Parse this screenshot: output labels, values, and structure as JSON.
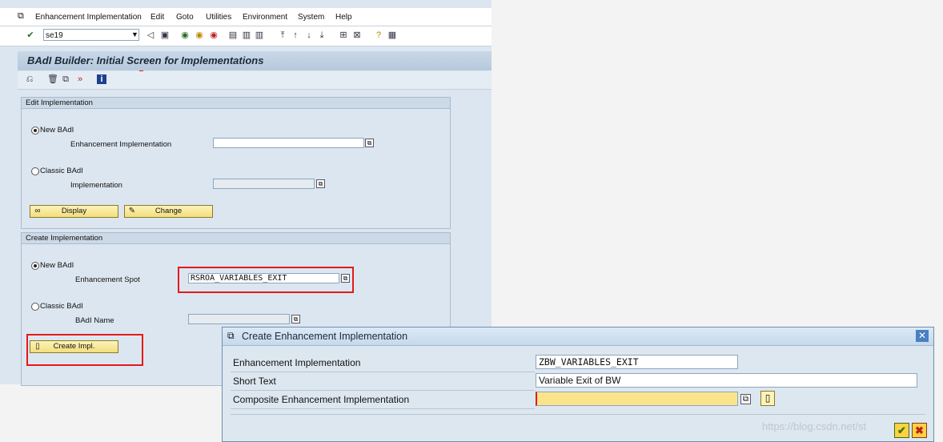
{
  "menu": [
    "Enhancement Implementation",
    "Edit",
    "Goto",
    "Utilities",
    "Environment",
    "System",
    "Help"
  ],
  "command_field": "se19",
  "screen_title": "BAdI Builder: Initial Screen for Implementations",
  "edit_group": {
    "title": "Edit Implementation",
    "radio_new": "New BAdI",
    "label_enh_impl": "Enhancement Implementation",
    "value_enh_impl": "",
    "radio_classic": "Classic BAdI",
    "label_impl": "Implementation",
    "value_impl": "",
    "btn_display": "Display",
    "btn_change": "Change"
  },
  "create_group": {
    "title": "Create Implementation",
    "radio_new": "New BAdI",
    "label_spot": "Enhancement Spot",
    "value_spot": "RSROA_VARIABLES_EXIT",
    "radio_classic": "Classic BAdI",
    "label_badi_name": "BAdI Name",
    "value_badi_name": "",
    "btn_create": "Create Impl."
  },
  "popup": {
    "title": "Create Enhancement Implementation",
    "label_enh_impl": "Enhancement Implementation",
    "value_enh_impl": "ZBW_VARIABLES_EXIT",
    "label_short_text": "Short Text",
    "value_short_text": "Variable Exit of BW",
    "label_composite": "Composite Enhancement Implementation",
    "value_composite": ""
  },
  "watermark": "https://blog.csdn.net/st",
  "colors": {
    "highlight": "#e31a1a",
    "button": "#f3de7e",
    "background": "#dce6f0"
  }
}
